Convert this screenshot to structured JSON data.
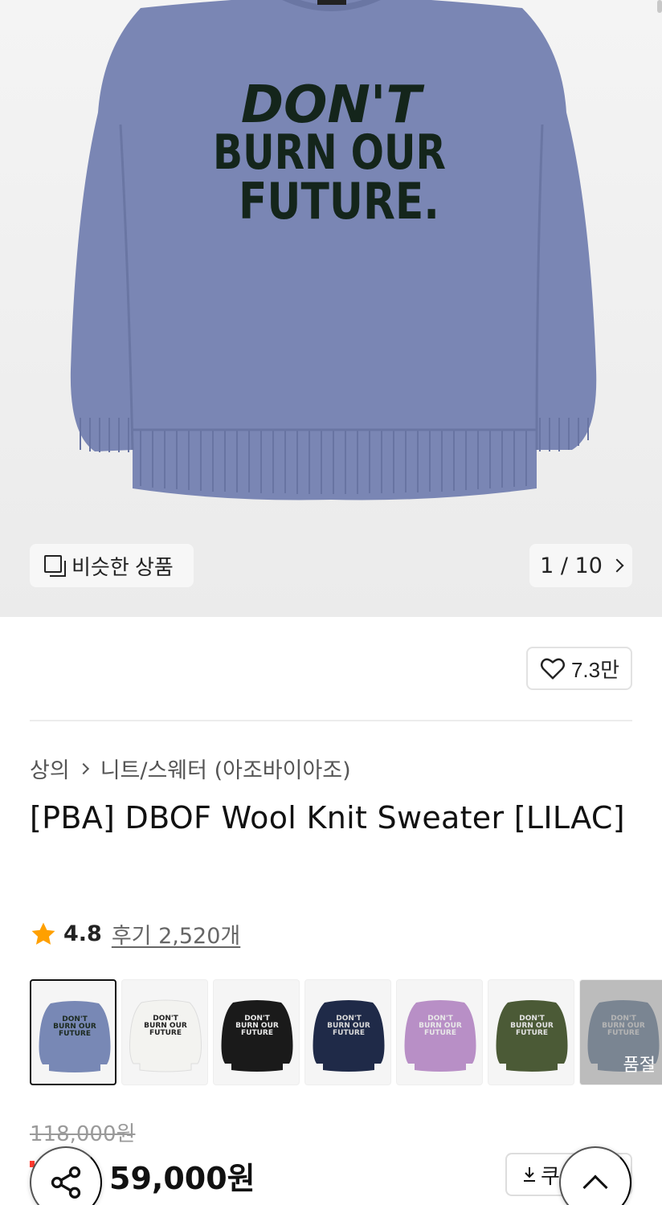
{
  "hero": {
    "graphic_text": [
      "DON'T",
      "BURN OUR",
      "FUTURE."
    ],
    "similar_label": "비슷한 상품",
    "pager_text": "1 / 10"
  },
  "like": {
    "count": "7.3만"
  },
  "breadcrumb": {
    "items": [
      "상의",
      "니트/스웨터 (아조바이아조)"
    ]
  },
  "product": {
    "title": "[PBA] DBOF Wool Knit Sweater [LILAC]",
    "rating": "4.8",
    "reviews": "후기 2,520개",
    "original_price": "118,000원",
    "sale_price": "59,000원"
  },
  "thumbnails": [
    {
      "color": "#7888b5",
      "text_color": "#1c2a1f",
      "selected": true,
      "sold_out": false
    },
    {
      "color": "#f3f3f0",
      "text_color": "#222222",
      "selected": false,
      "sold_out": false
    },
    {
      "color": "#1a1a1a",
      "text_color": "#e9e9e9",
      "selected": false,
      "sold_out": false
    },
    {
      "color": "#1f2a48",
      "text_color": "#d9d9d9",
      "selected": false,
      "sold_out": false
    },
    {
      "color": "#b88fc6",
      "text_color": "#e8e8e8",
      "selected": false,
      "sold_out": false
    },
    {
      "color": "#4b5a36",
      "text_color": "#e3e3e3",
      "selected": false,
      "sold_out": false
    },
    {
      "color": "#7d90a8",
      "text_color": "#e6e6e6",
      "selected": false,
      "sold_out": true
    }
  ],
  "soldout_label": "품절",
  "coupon": {
    "label": "쿠"
  },
  "colors": {
    "sweater": "#7a86b4",
    "sweater_shadow": "#6a76a3",
    "graphic": "#14251b",
    "star": "#ffa000",
    "discount": "#ff3b30"
  },
  "icons": {
    "similar": "similar-icon",
    "heart": "heart-icon",
    "star": "star-icon",
    "share": "share-icon",
    "download": "download-icon",
    "up": "chevron-up-icon"
  }
}
